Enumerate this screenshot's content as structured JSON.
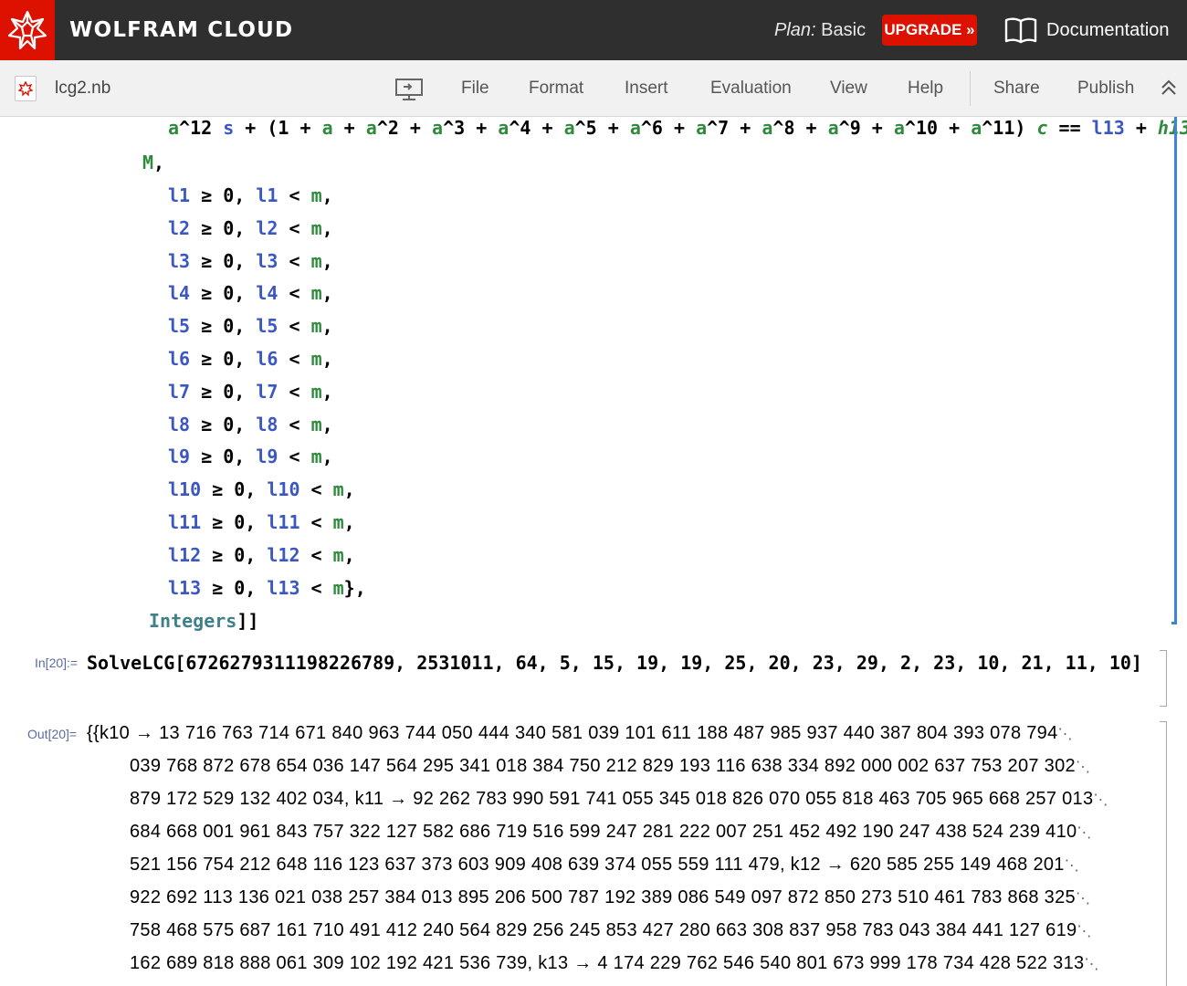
{
  "header": {
    "brand": "WOLFRAM CLOUD",
    "plan_label": "Plan:",
    "plan_value": "Basic",
    "upgrade": "UPGRADE »",
    "documentation": "Documentation"
  },
  "toolbar": {
    "notebook_name": "lcg2.nb",
    "menu": [
      "File",
      "Format",
      "Insert",
      "Evaluation",
      "View",
      "Help"
    ],
    "share": "Share",
    "publish": "Publish"
  },
  "input_cell": {
    "label": "In[20]:=",
    "code": "SolveLCG[6726279311198226789, 2531011, 64, 5, 15, 19, 19, 25, 20, 23, 29, 2, 23, 10, 21, 11, 10]"
  },
  "output_cell": {
    "label": "Out[20]=",
    "lines": [
      "{{k10 → 13 716 763 714 671 840 963 744 050 444 340 581 039 101 611 188 487 985 937 440 387 804 393 078 794",
      "039 768 872 678 654 036 147 564 295 341 018 384 750 212 829 193 116 638 334 892 000 002 637 753 207 302",
      "879 172 529 132 402 034, k11 → 92 262 783 990 591 741 055 345 018 826 070 055 818 463 705 965 668 257 013",
      "684 668 001 961 843 757 322 127 582 686 719 516 599 247 281 222 007 251 452 492 190 247 438 524 239 410",
      "521 156 754 212 648 116 123 637 373 603 909 408 639 374 055 559 111 479, k12 → 620 585 255 149 468 201",
      "922 692 113 136 021 038 257 384 013 895 206 500 787 192 389 086 549 097 872 850 273 510 461 783 868 325",
      "758 468 575 687 161 710 491 412 240 564 829 256 245 853 427 280 663 308 837 958 783 043 384 441 127 619",
      "162 689 818 888 061 309 102 192 421 536 739, k13 → 4 174 229 762 546 540 801 673 999 178 734 428 522 313"
    ]
  },
  "code_cell": {
    "constraint_indices": [
      "1",
      "2",
      "3",
      "4",
      "5",
      "6",
      "7",
      "8",
      "9",
      "10",
      "11",
      "12",
      "13"
    ],
    "integers": "Integers"
  },
  "colors": {
    "topbar": "#2f2f2f",
    "accent_red": "#dd1100",
    "variable_blue": "#3a57c4",
    "symbol_green": "#2e8a3c",
    "cell_bracket_blue": "#3e84d6"
  }
}
